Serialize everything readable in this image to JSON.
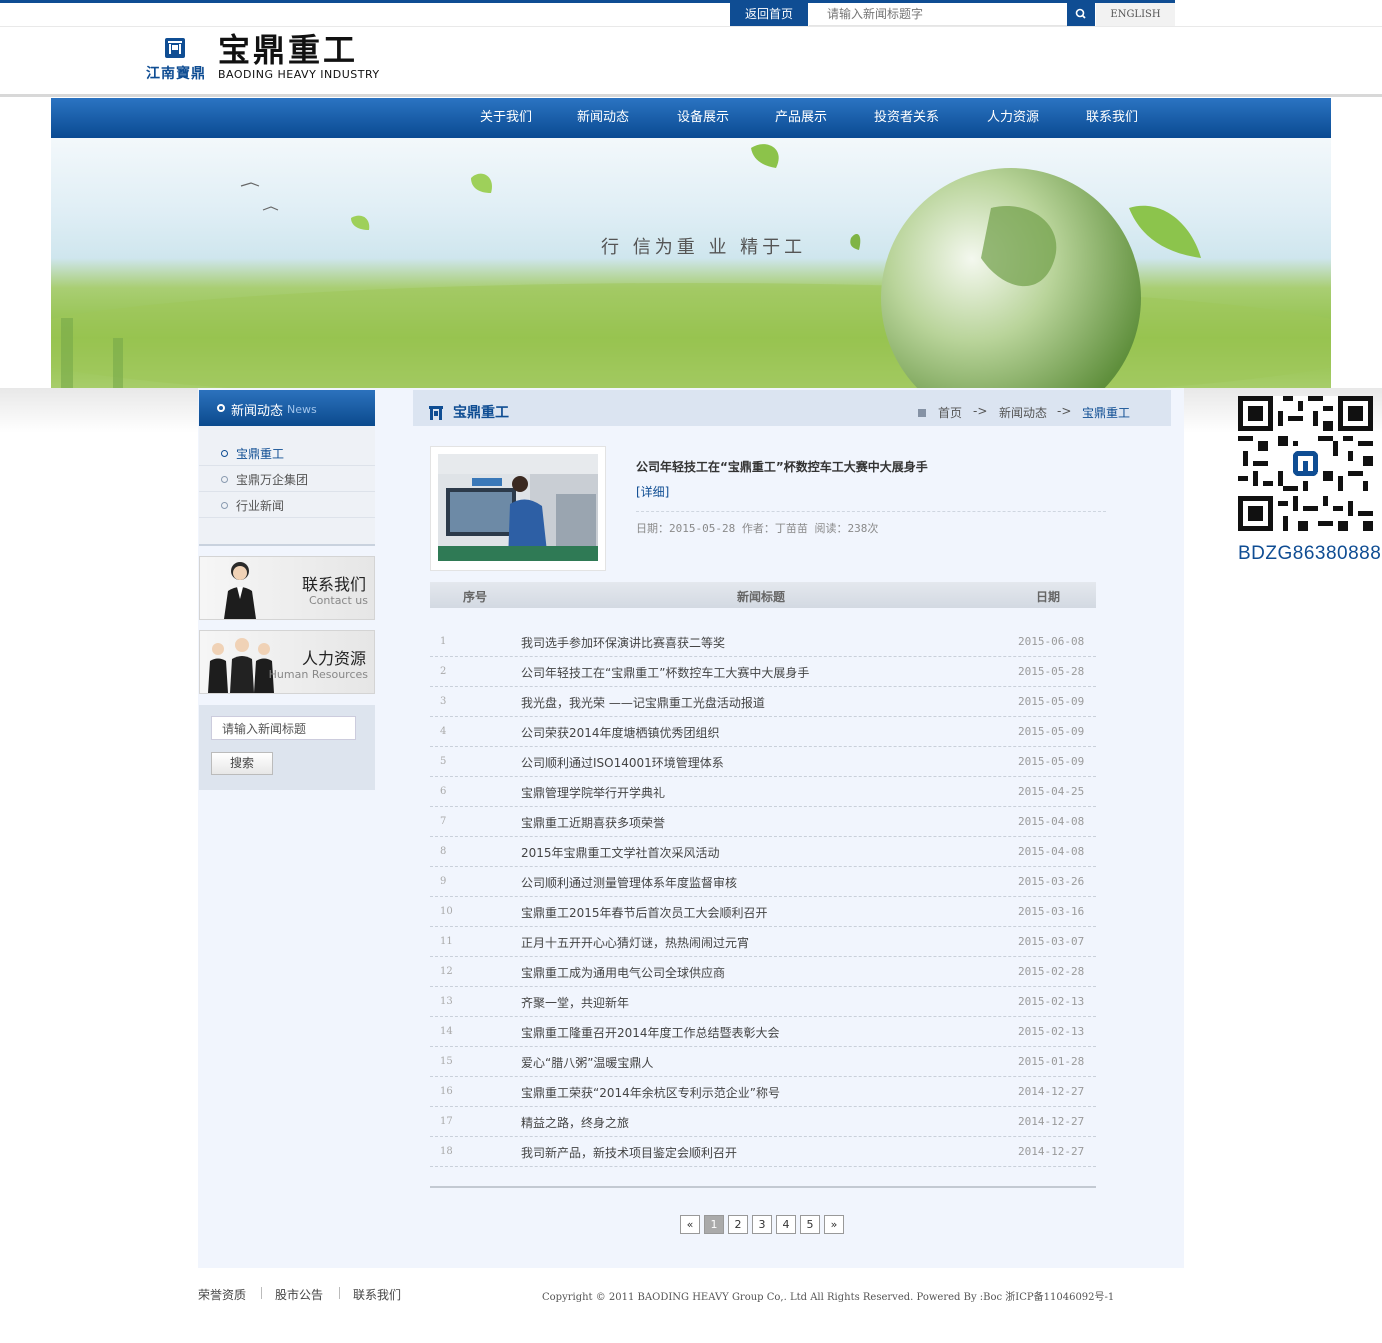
{
  "topbar": {
    "home_label": "返回首页",
    "search_placeholder": "请输入新闻标题字",
    "english_label": "ENGLISH"
  },
  "logo": {
    "cn_small": "江南寶鼎",
    "cn": "宝鼎重工",
    "en": "BAODING HEAVY INDUSTRY"
  },
  "nav": [
    "关于我们",
    "新闻动态",
    "设备展示",
    "产品展示",
    "投资者关系",
    "人力资源",
    "联系我们"
  ],
  "banner": {
    "slogan": "行 信为重 业 精于工"
  },
  "sidebar": {
    "head_title": "新闻动态",
    "head_en": "News",
    "items": [
      "宝鼎重工",
      "宝鼎万企集团",
      "行业新闻"
    ],
    "contact_title": "联系我们",
    "contact_en": "Contact us",
    "hr_title": "人力资源",
    "hr_en": "Human Resources",
    "search_placeholder": "请输入新闻标题",
    "search_button": "搜索"
  },
  "main": {
    "title": "宝鼎重工",
    "breadcrumb": {
      "home": "首页",
      "sep": "->",
      "news": "新闻动态",
      "current": "宝鼎重工"
    }
  },
  "featured": {
    "title": "公司年轻技工在“宝鼎重工”杯数控车工大赛中大展身手",
    "detail": "[详细]",
    "meta": "日期：2015-05-28  作者：丁苗苗  阅读：238次"
  },
  "table": {
    "headers": [
      "序号",
      "新闻标题",
      "日期"
    ],
    "rows": [
      {
        "n": "1",
        "t": "我司选手参加环保演讲比赛喜获二等奖",
        "d": "2015-06-08"
      },
      {
        "n": "2",
        "t": "公司年轻技工在“宝鼎重工”杯数控车工大赛中大展身手",
        "d": "2015-05-28"
      },
      {
        "n": "3",
        "t": "我光盘，我光荣 ——记宝鼎重工光盘活动报道",
        "d": "2015-05-09"
      },
      {
        "n": "4",
        "t": "公司荣获2014年度塘栖镇优秀团组织",
        "d": "2015-05-09"
      },
      {
        "n": "5",
        "t": "公司顺利通过ISO14001环境管理体系",
        "d": "2015-05-09"
      },
      {
        "n": "6",
        "t": "宝鼎管理学院举行开学典礼",
        "d": "2015-04-25"
      },
      {
        "n": "7",
        "t": "宝鼎重工近期喜获多项荣誉",
        "d": "2015-04-08"
      },
      {
        "n": "8",
        "t": "2015年宝鼎重工文学社首次采风活动",
        "d": "2015-04-08"
      },
      {
        "n": "9",
        "t": "公司顺利通过测量管理体系年度监督审核",
        "d": "2015-03-26"
      },
      {
        "n": "10",
        "t": "宝鼎重工2015年春节后首次员工大会顺利召开",
        "d": "2015-03-16"
      },
      {
        "n": "11",
        "t": "正月十五开开心心猜灯谜，热热闹闹过元宵",
        "d": "2015-03-07"
      },
      {
        "n": "12",
        "t": "宝鼎重工成为通用电气公司全球供应商",
        "d": "2015-02-28"
      },
      {
        "n": "13",
        "t": "齐聚一堂，共迎新年",
        "d": "2015-02-13"
      },
      {
        "n": "14",
        "t": "宝鼎重工隆重召开2014年度工作总结暨表彰大会",
        "d": "2015-02-13"
      },
      {
        "n": "15",
        "t": "爱心“腊八粥”温暖宝鼎人",
        "d": "2015-01-28"
      },
      {
        "n": "16",
        "t": "宝鼎重工荣获“2014年余杭区专利示范企业”称号",
        "d": "2014-12-27"
      },
      {
        "n": "17",
        "t": "精益之路，终身之旅",
        "d": "2014-12-27"
      },
      {
        "n": "18",
        "t": "我司新产品，新技术项目鉴定会顺利召开",
        "d": "2014-12-27"
      }
    ]
  },
  "pager": {
    "prev": "«",
    "pages": [
      "1",
      "2",
      "3",
      "4",
      "5"
    ],
    "current": "1",
    "next": "»"
  },
  "footer": {
    "links": [
      "荣誉资质",
      "股市公告",
      "联系我们"
    ],
    "copyright": "Copyright © 2011 BAODING HEAVY Group Co,. Ltd All Rights Reserved.  Powered By :Boc 浙ICP备11046092号-1"
  },
  "qr": {
    "code": "BDZG86380888"
  },
  "colors": {
    "brand_blue": "#0f4d93",
    "nav_gradient_top": "#2b74c2",
    "content_bg": "#f1f5fd"
  }
}
